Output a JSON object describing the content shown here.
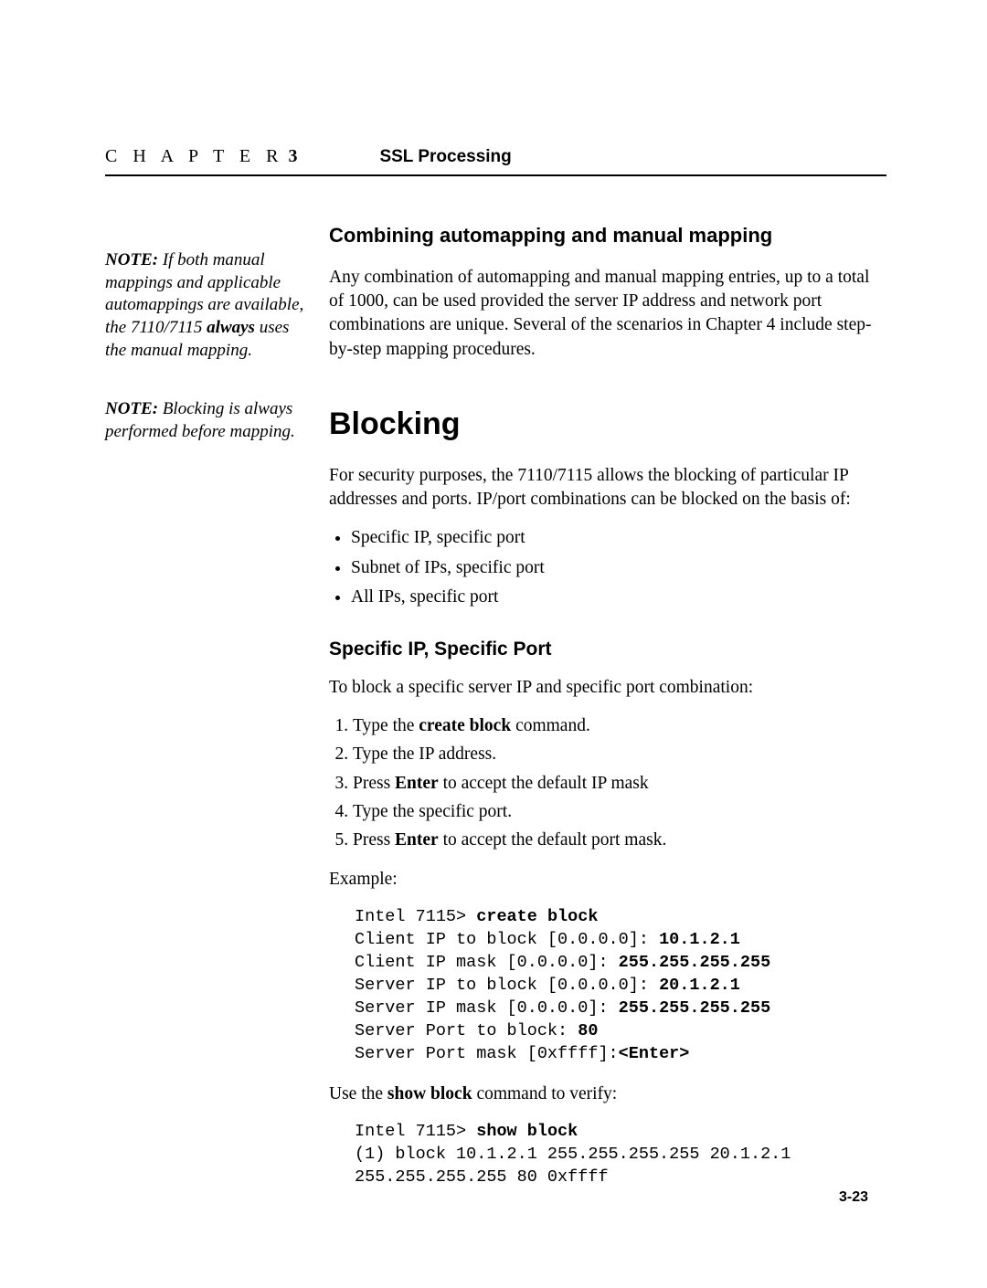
{
  "header": {
    "chapterWord": "C H A P T E R",
    "chapterNumber": "3",
    "title": "SSL Processing"
  },
  "sidebar": {
    "note1": {
      "label": "NOTE:",
      "before": "  If both manual mappings and applicable automappings are available, the 7110/7115 ",
      "boldWord": "always",
      "after": " uses the manual mapping."
    },
    "note2": {
      "label": "NOTE:",
      "text": "  Blocking is always performed before mapping."
    }
  },
  "main": {
    "h2": "Combining automapping and manual mapping",
    "p1": "Any combination of automapping and manual mapping entries, up to a total of 1000, can be used provided the server IP address and network port combinations are unique. Several of the scenarios in Chapter 4 include step-by-step mapping procedures.",
    "h1": "Blocking",
    "p2": "For security purposes, the 7110/7115 allows the blocking of particular IP addresses and ports. IP/port combinations can be blocked on the basis of:",
    "bullets": [
      "Specific IP, specific port",
      "Subnet of IPs, specific port",
      "All IPs, specific port"
    ],
    "h3": "Specific IP, Specific Port",
    "p3": "To block a specific server IP and specific port combination:",
    "steps": {
      "s1a": "Type the ",
      "s1b": "create block",
      "s1c": " command.",
      "s2": "Type the IP address.",
      "s3a": "Press ",
      "s3b": "Enter",
      "s3c": " to accept the default IP mask",
      "s4": "Type the specific port.",
      "s5a": "Press ",
      "s5b": "Enter",
      "s5c": " to accept the default port mask."
    },
    "p4": "Example:",
    "code1": {
      "l1a": "Intel 7115> ",
      "l1b": "create block",
      "l2a": "Client IP to block [0.0.0.0]: ",
      "l2b": "10.1.2.1",
      "l3a": "Client IP mask [0.0.0.0]: ",
      "l3b": "255.255.255.255",
      "l4a": "Server IP to block [0.0.0.0]: ",
      "l4b": "20.1.2.1",
      "l5a": "Server IP mask [0.0.0.0]: ",
      "l5b": "255.255.255.255",
      "l6a": "Server Port to block: ",
      "l6b": "80",
      "l7a": "Server Port mask [0xffff]:",
      "l7b": "<Enter>"
    },
    "p5a": "Use the ",
    "p5b": "show block",
    "p5c": " command to verify:",
    "code2": {
      "l1a": "Intel 7115> ",
      "l1b": "show block",
      "l2": "(1) block 10.1.2.1 255.255.255.255 20.1.2.1",
      "l3": "255.255.255.255 80 0xffff"
    }
  },
  "footer": {
    "pageNumber": "3-23"
  }
}
